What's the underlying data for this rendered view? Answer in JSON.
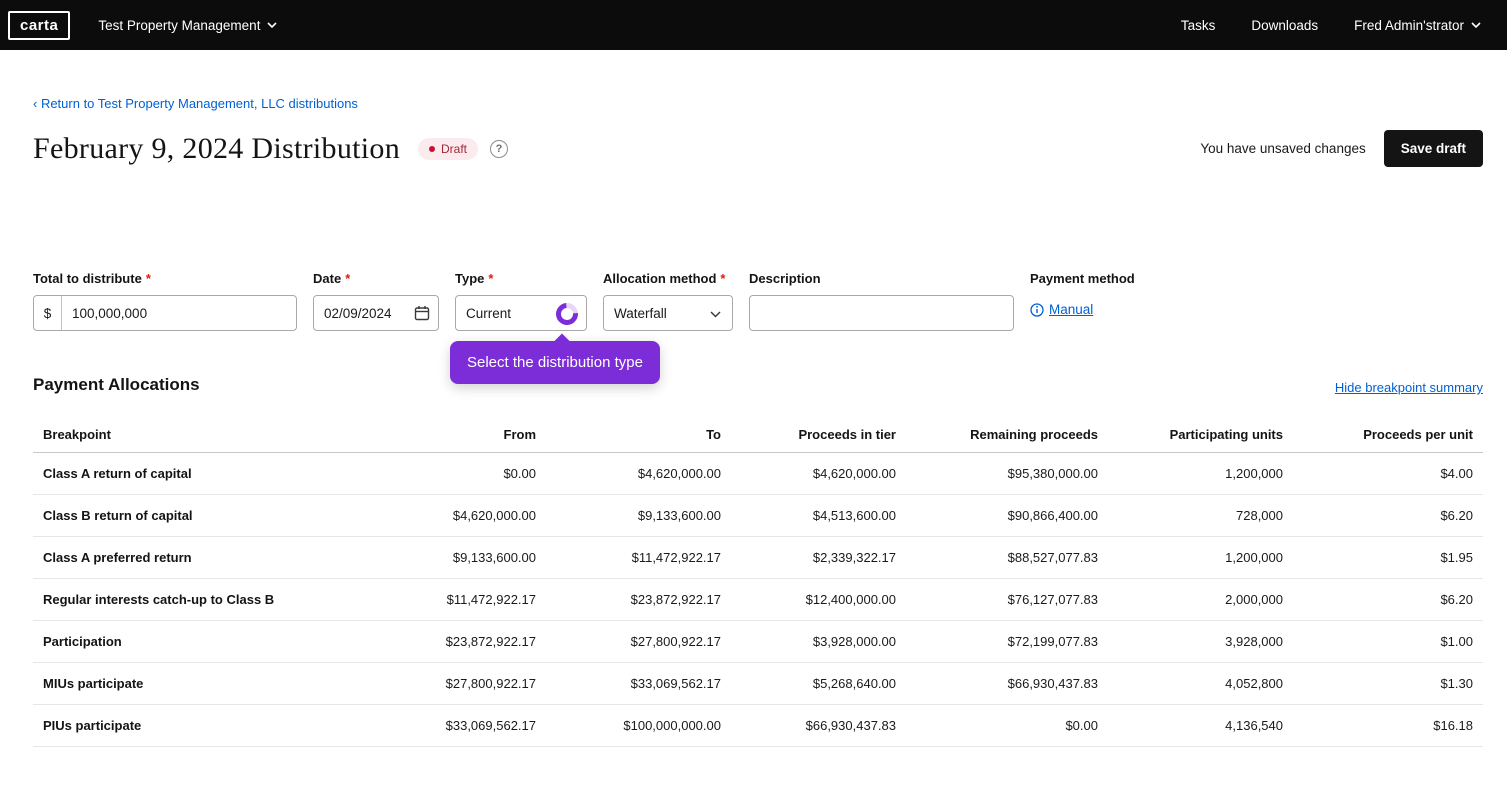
{
  "colors": {
    "topbar_black": "#0c0c0d",
    "link_blue": "#0061d5",
    "tour_purple": "#7d2dd8",
    "badge_bg": "#fcebee",
    "badge_text": "#a32638",
    "badge_dot": "#c41230",
    "required_red": "#d91f11",
    "save_button_bg": "#141414"
  },
  "icons": {
    "help": "?",
    "info": "i"
  },
  "header": {
    "logo": "carta",
    "company": "Test Property Management",
    "nav": [
      {
        "label": "Tasks"
      },
      {
        "label": "Downloads"
      }
    ],
    "user": "Fred Admin'strator"
  },
  "breadcrumb": "‹ Return to Test Property Management, LLC distributions",
  "page": {
    "title": "February 9, 2024 Distribution",
    "status_badge": "Draft",
    "unsaved_text": "You have unsaved changes",
    "save_button": "Save draft"
  },
  "required_marker": "*",
  "form": {
    "total": {
      "label": "Total to distribute",
      "prefix": "$",
      "value": "100,000,000"
    },
    "date": {
      "label": "Date",
      "value": "02/09/2024"
    },
    "type": {
      "label": "Type",
      "value": "Current"
    },
    "allocation": {
      "label": "Allocation method",
      "value": "Waterfall"
    },
    "description": {
      "label": "Description",
      "value": ""
    },
    "payment_method": {
      "label": "Payment method",
      "link_label": "Manual"
    }
  },
  "tooltip": {
    "text": "Select the distribution type"
  },
  "allocations": {
    "heading": "Payment Allocations",
    "toggle_link": "Hide breakpoint summary",
    "columns": [
      "Breakpoint",
      "From",
      "To",
      "Proceeds in tier",
      "Remaining proceeds",
      "Participating units",
      "Proceeds per unit"
    ],
    "rows": [
      [
        "Class A return of capital",
        "$0.00",
        "$4,620,000.00",
        "$4,620,000.00",
        "$95,380,000.00",
        "1,200,000",
        "$4.00"
      ],
      [
        "Class B return of capital",
        "$4,620,000.00",
        "$9,133,600.00",
        "$4,513,600.00",
        "$90,866,400.00",
        "728,000",
        "$6.20"
      ],
      [
        "Class A preferred return",
        "$9,133,600.00",
        "$11,472,922.17",
        "$2,339,322.17",
        "$88,527,077.83",
        "1,200,000",
        "$1.95"
      ],
      [
        "Regular interests catch-up to Class B",
        "$11,472,922.17",
        "$23,872,922.17",
        "$12,400,000.00",
        "$76,127,077.83",
        "2,000,000",
        "$6.20"
      ],
      [
        "Participation",
        "$23,872,922.17",
        "$27,800,922.17",
        "$3,928,000.00",
        "$72,199,077.83",
        "3,928,000",
        "$1.00"
      ],
      [
        "MIUs participate",
        "$27,800,922.17",
        "$33,069,562.17",
        "$5,268,640.00",
        "$66,930,437.83",
        "4,052,800",
        "$1.30"
      ],
      [
        "PIUs participate",
        "$33,069,562.17",
        "$100,000,000.00",
        "$66,930,437.83",
        "$0.00",
        "4,136,540",
        "$16.18"
      ]
    ]
  }
}
